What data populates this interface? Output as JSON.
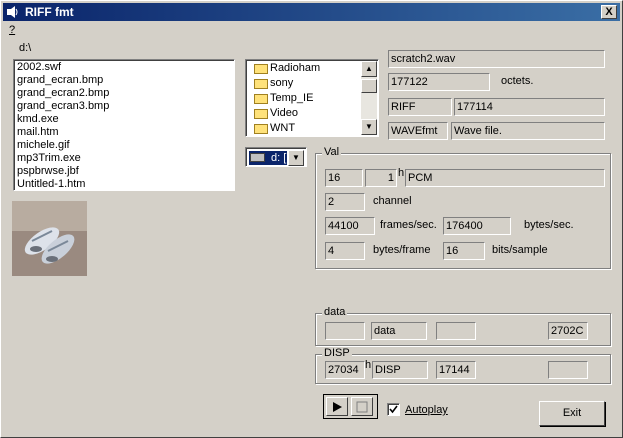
{
  "window": {
    "title": "RIFF  fmt",
    "close": "X"
  },
  "menu": {
    "help": "?"
  },
  "path": "d:\\",
  "files": [
    "2002.swf",
    "grand_ecran.bmp",
    "grand_ecran2.bmp",
    "grand_ecran3.bmp",
    "kmd.exe",
    "mail.htm",
    "michele.gif",
    "mp3Trim.exe",
    "pspbrwse.jbf",
    "Untitled-1.htm"
  ],
  "folders": [
    "Radioham",
    "sony",
    "Temp_IE",
    "Video",
    "WNT"
  ],
  "drive": {
    "value": "d: ["
  },
  "info": {
    "filename": "scratch2.wav",
    "size": "177122",
    "size_unit": "octets.",
    "riff": "RIFF",
    "riff_size": "177114",
    "wavefmt": "WAVEfmt",
    "wave_desc": "Wave file."
  },
  "val": {
    "title": "Val",
    "fmt_size": "16",
    "fmt_tag": "1",
    "h_label": "h",
    "codec": "PCM",
    "channels": "2",
    "channel_label": "channel",
    "sample_rate": "44100",
    "sample_rate_label": "frames/sec.",
    "byte_rate": "176400",
    "byte_rate_label": "bytes/sec.",
    "block_align": "4",
    "block_align_label": "bytes/frame",
    "bits": "16",
    "bits_label": "bits/sample"
  },
  "data": {
    "title": "data",
    "f1": "",
    "f2": "data",
    "f3": "",
    "f4": "2702C"
  },
  "disp": {
    "title": "DISP",
    "f1": "27034",
    "h_label": "h",
    "f2": "DISP",
    "f3": "17144",
    "f4": ""
  },
  "controls": {
    "autoplay_label": "Autoplay",
    "autoplay_checked": true,
    "exit_label": "Exit"
  },
  "icons": [
    "app-icon",
    "folder-icon",
    "drive-icon",
    "play-icon",
    "stop-icon",
    "scroll-up-icon",
    "scroll-down-icon",
    "dropdown-arrow-icon",
    "checkmark-icon"
  ]
}
